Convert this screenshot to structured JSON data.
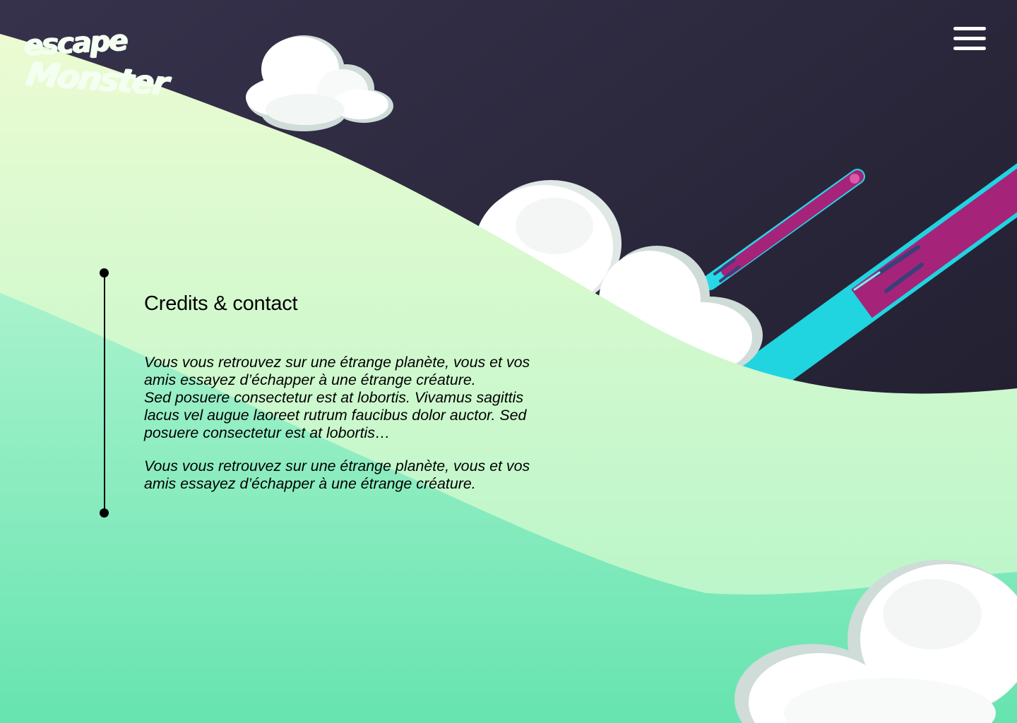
{
  "header": {
    "logo_text_line1": "escape",
    "logo_text_line2": "Monster",
    "menu_icon": "hamburger-menu-icon"
  },
  "colors": {
    "sky_top": "#34304a",
    "sky_bottom": "#221f30",
    "hill_light": "#e6fbcf",
    "hill_mid": "#b6f5c4",
    "hill_dark": "#6ee6b0",
    "meteor_pink": "#a6237a",
    "meteor_cyan": "#00e0e0",
    "text": "#000000"
  },
  "main": {
    "title": "Credits & contact",
    "paragraph1": "Vous vous retrouvez sur une étrange planète, vous et vos\namis essayez d’échapper à une étrange créature.\nSed posuere consectetur est at lobortis. Vivamus sagittis\nlacus vel augue laoreet rutrum faucibus dolor auctor. Sed\nposuere consectetur est at lobortis…",
    "paragraph2": "Vous vous retrouvez sur une étrange planète, vous et vos\namis essayez d’échapper à une étrange créature."
  }
}
